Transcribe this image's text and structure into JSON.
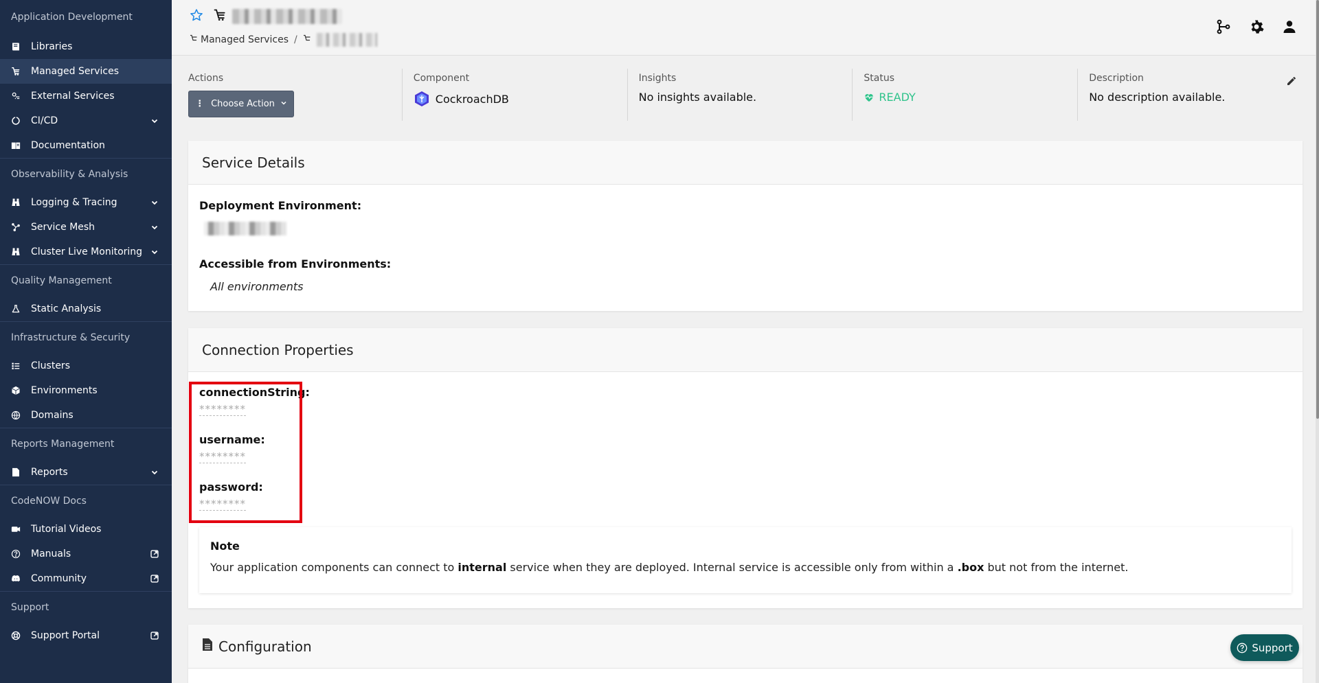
{
  "sidebar": {
    "sections": [
      {
        "title": "Application Development",
        "items": [
          {
            "label": "Libraries",
            "icon": "book-icon"
          },
          {
            "label": "Managed Services",
            "icon": "managed-services-icon",
            "active": true
          },
          {
            "label": "External Services",
            "icon": "external-services-icon"
          },
          {
            "label": "CI/CD",
            "icon": "cicd-icon",
            "expand": true
          },
          {
            "label": "Documentation",
            "icon": "documentation-icon"
          }
        ]
      },
      {
        "title": "Observability & Analysis",
        "items": [
          {
            "label": "Logging & Tracing",
            "icon": "binoculars-icon",
            "expand": true
          },
          {
            "label": "Service Mesh",
            "icon": "service-mesh-icon",
            "expand": true
          },
          {
            "label": "Cluster Live Monitoring",
            "icon": "binoculars-icon",
            "expand": true
          }
        ]
      },
      {
        "title": "Quality Management",
        "items": [
          {
            "label": "Static Analysis",
            "icon": "flask-icon"
          }
        ]
      },
      {
        "title": "Infrastructure & Security",
        "items": [
          {
            "label": "Clusters",
            "icon": "list-icon"
          },
          {
            "label": "Environments",
            "icon": "cube-icon"
          },
          {
            "label": "Domains",
            "icon": "globe-icon"
          }
        ]
      },
      {
        "title": "Reports Management",
        "items": [
          {
            "label": "Reports",
            "icon": "csv-file-icon",
            "expand": true
          }
        ]
      },
      {
        "title": "CodeNOW Docs",
        "items": [
          {
            "label": "Tutorial Videos",
            "icon": "video-icon"
          },
          {
            "label": "Manuals",
            "icon": "question-icon",
            "external": true
          },
          {
            "label": "Community",
            "icon": "discord-icon",
            "external": true
          }
        ]
      },
      {
        "title": "Support",
        "items": [
          {
            "label": "Support Portal",
            "icon": "lifebuoy-icon",
            "external": true
          }
        ]
      }
    ]
  },
  "header": {
    "breadcrumb_root": "Managed Services",
    "breadcrumb_sep": "/"
  },
  "info": {
    "actions_label": "Actions",
    "choose_action": "Choose Action",
    "component_label": "Component",
    "component_value": "CockroachDB",
    "insights_label": "Insights",
    "insights_value": "No insights available.",
    "status_label": "Status",
    "status_value": "READY",
    "description_label": "Description",
    "description_value": "No description available."
  },
  "service_details": {
    "title": "Service Details",
    "deployment_env_label": "Deployment Environment:",
    "accessible_label": "Accessible from Environments:",
    "accessible_value": "All environments"
  },
  "connection": {
    "title": "Connection Properties",
    "fields": [
      {
        "label": "connectionString:",
        "value": "********"
      },
      {
        "label": "username:",
        "value": "********"
      },
      {
        "label": "password:",
        "value": "********"
      }
    ],
    "note_title": "Note",
    "note_part1": "Your application components can connect to ",
    "note_bold1": "internal",
    "note_part2": " service when they are deployed. Internal service is accessible only from within a ",
    "note_bold2": ".box",
    "note_part3": " but not from the internet."
  },
  "configuration": {
    "title": "Configuration"
  },
  "support_button": "Support",
  "colors": {
    "sidebar_bg": "#1d2d48",
    "status_ready": "#2fc38b",
    "highlight": "#e30010",
    "support_btn": "#0f5a5b"
  }
}
